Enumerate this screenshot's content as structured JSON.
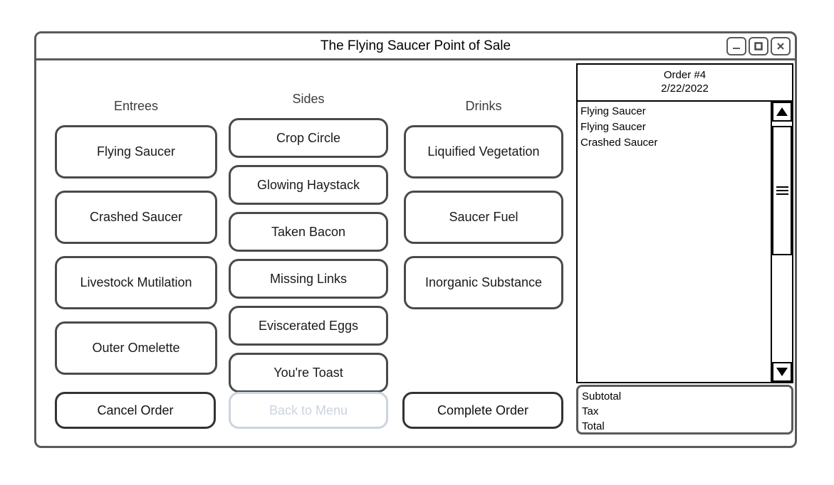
{
  "window": {
    "title": "The Flying Saucer Point of Sale",
    "controls": [
      {
        "name": "minimize",
        "glyph": "_"
      },
      {
        "name": "maximize",
        "glyph": "square"
      },
      {
        "name": "close",
        "glyph": "x"
      }
    ]
  },
  "columns": {
    "entrees": {
      "header": "Entrees",
      "items": [
        "Flying Saucer",
        "Crashed Saucer",
        "Livestock Mutilation",
        "Outer Omelette"
      ]
    },
    "sides": {
      "header": "Sides",
      "items": [
        "Crop Circle",
        "Glowing Haystack",
        "Taken Bacon",
        "Missing Links",
        "Eviscerated Eggs",
        "You're Toast"
      ]
    },
    "drinks": {
      "header": "Drinks",
      "items": [
        "Liquified Vegetation",
        "Saucer Fuel",
        "Inorganic Substance"
      ]
    }
  },
  "actions": {
    "cancel": "Cancel Order",
    "back": "Back to Menu",
    "back_disabled": true,
    "complete": "Complete Order"
  },
  "order": {
    "number": "Order #4",
    "date": "2/22/2022",
    "items": [
      "Flying Saucer",
      "Flying Saucer",
      "Crashed Saucer"
    ],
    "totals": [
      "Subtotal",
      "Tax",
      "Total"
    ]
  },
  "colors": {
    "frame": "#5a5a5a",
    "button_border": "#4a4a4a",
    "disabled": "#ccd4e0",
    "panel_border": "#000000"
  }
}
